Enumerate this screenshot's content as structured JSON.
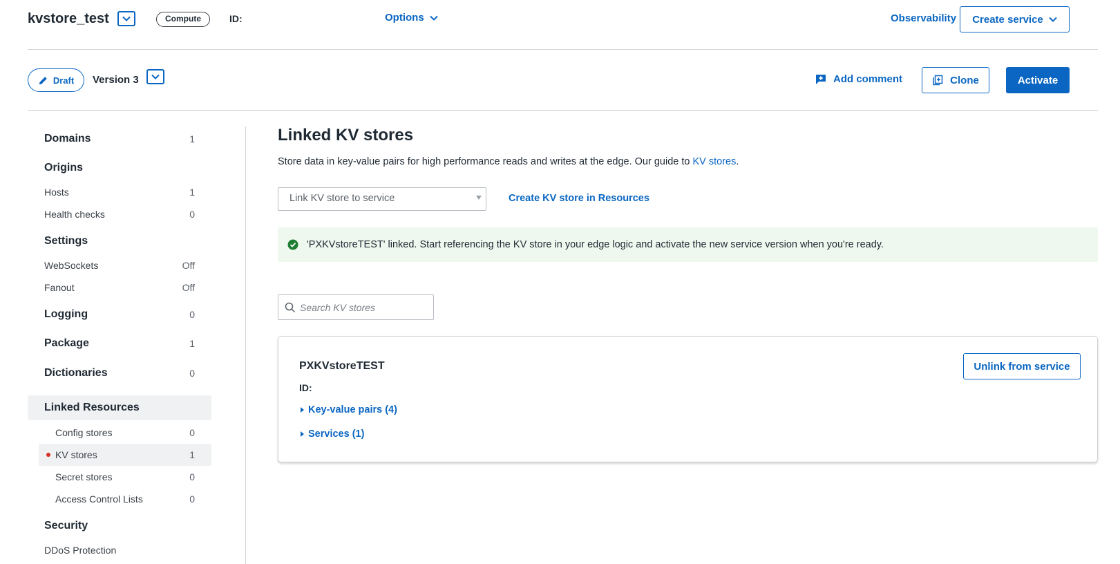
{
  "header": {
    "service_name": "kvstore_test",
    "type_badge": "Compute",
    "id_label": "ID:",
    "options_label": "Options",
    "observability_label": "Observability",
    "create_service_label": "Create service"
  },
  "version_bar": {
    "draft_label": "Draft",
    "version_label": "Version 3",
    "add_comment_label": "Add comment",
    "clone_label": "Clone",
    "activate_label": "Activate"
  },
  "sidebar": {
    "domains": {
      "label": "Domains",
      "count": "1"
    },
    "origins": {
      "label": "Origins"
    },
    "hosts": {
      "label": "Hosts",
      "count": "1"
    },
    "health_checks": {
      "label": "Health checks",
      "count": "0"
    },
    "settings": {
      "label": "Settings"
    },
    "websockets": {
      "label": "WebSockets",
      "count": "Off"
    },
    "fanout": {
      "label": "Fanout",
      "count": "Off"
    },
    "logging": {
      "label": "Logging",
      "count": "0"
    },
    "package": {
      "label": "Package",
      "count": "1"
    },
    "dictionaries": {
      "label": "Dictionaries",
      "count": "0"
    },
    "linked_resources": {
      "label": "Linked Resources"
    },
    "config_stores": {
      "label": "Config stores",
      "count": "0"
    },
    "kv_stores": {
      "label": "KV stores",
      "count": "1"
    },
    "secret_stores": {
      "label": "Secret stores",
      "count": "0"
    },
    "acls": {
      "label": "Access Control Lists",
      "count": "0"
    },
    "security": {
      "label": "Security"
    },
    "ddos": {
      "label": "DDoS Protection"
    }
  },
  "main": {
    "title": "Linked KV stores",
    "description": "Store data in key-value pairs for high performance reads and writes at the edge. Our guide to ",
    "description_link": "KV stores",
    "description_end": ".",
    "link_select_placeholder": "Link KV store to service",
    "create_kv_link": "Create KV store in Resources",
    "alert_text": "'PXKVstoreTEST' linked. Start referencing the KV store in your edge logic and activate the new service version when you're ready.",
    "search_placeholder": "Search KV stores",
    "card": {
      "name": "PXKVstoreTEST",
      "id_label": "ID:",
      "key_value_pairs": "Key-value pairs (4)",
      "services": "Services (1)",
      "unlink_label": "Unlink from service"
    }
  },
  "colors": {
    "accent": "#0a66c2",
    "success": "#1e7d32",
    "alert_bg": "#eef8ee",
    "notification_dot": "#d93025"
  }
}
